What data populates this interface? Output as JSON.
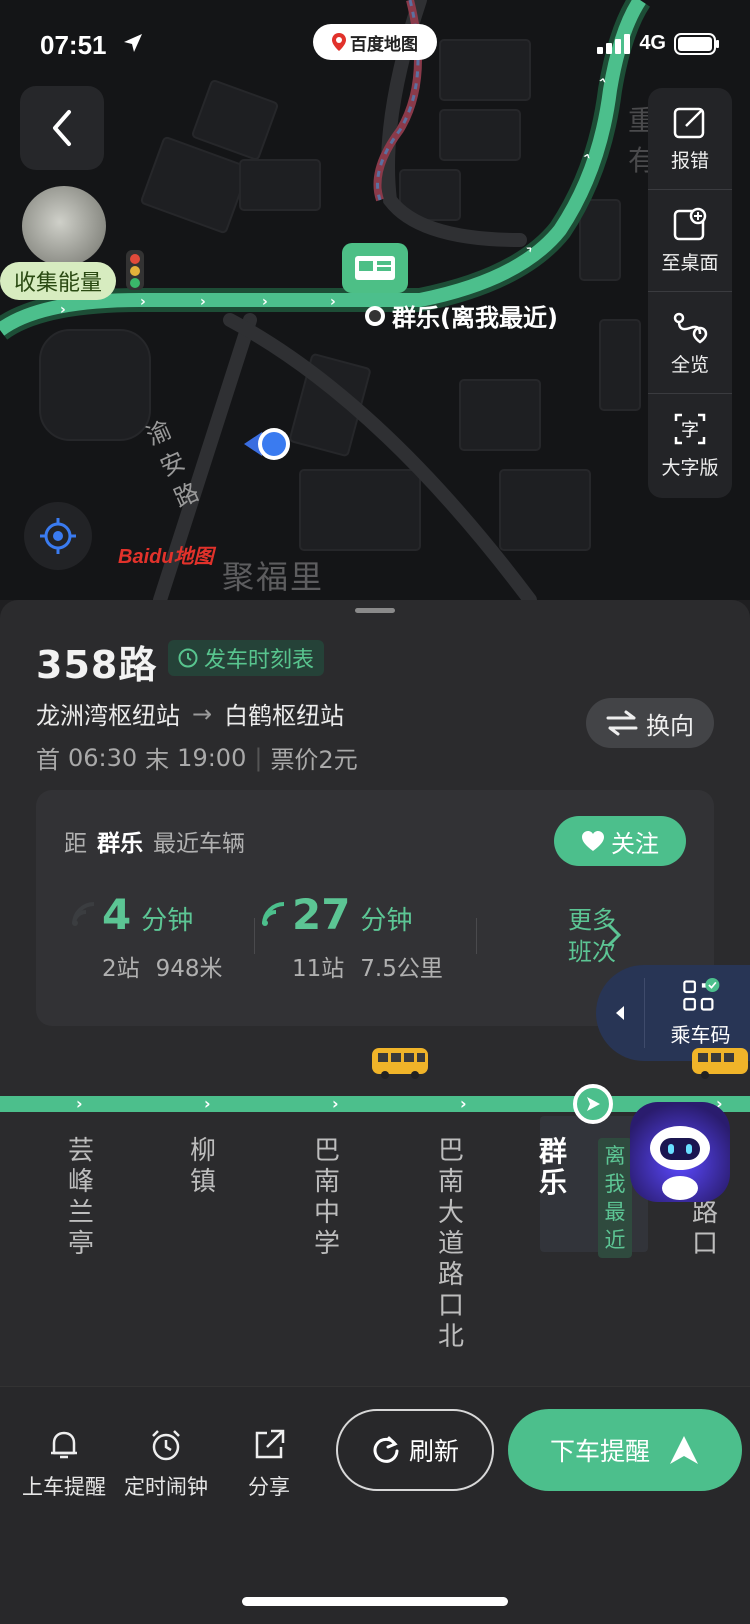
{
  "status_bar": {
    "time": "07:51",
    "network": "4G"
  },
  "app_pill": "百度地图",
  "map": {
    "energy_label": "收集能量",
    "stop_label": "群乐(离我最近)",
    "road_name": "渝安路",
    "area_name": "聚福里",
    "logo_text": "Baidu地图"
  },
  "side_panel": [
    {
      "label": "报错",
      "icon": "edit-icon"
    },
    {
      "label": "至桌面",
      "icon": "add-to-desktop-icon"
    },
    {
      "label": "全览",
      "icon": "route-overview-icon"
    },
    {
      "label": "大字版",
      "icon": "large-text-icon"
    }
  ],
  "route": {
    "name": "358路",
    "timetable_label": "发车时刻表",
    "from": "龙洲湾枢纽站",
    "to": "白鹤枢纽站",
    "first_label": "首",
    "first_time": "06:30",
    "last_label": "末",
    "last_time": "19:00",
    "fare": "票价2元",
    "swap_label": "换向"
  },
  "nearest": {
    "prefix": "距",
    "stop": "群乐",
    "suffix": "最近车辆",
    "follow_label": "关注",
    "buses": [
      {
        "minutes": "4",
        "unit": "分钟",
        "stops": "2站",
        "distance": "948米"
      },
      {
        "minutes": "27",
        "unit": "分钟",
        "stops": "11站",
        "distance": "7.5公里"
      }
    ],
    "more_label_1": "更多",
    "more_label_2": "班次"
  },
  "ride_code_label": "乘车码",
  "stops": [
    {
      "name": "芸峰兰亭",
      "chars": [
        "芸",
        "峰",
        "兰",
        "亭"
      ]
    },
    {
      "name": "柳镇",
      "chars": [
        "柳",
        "镇"
      ]
    },
    {
      "name": "巴南中学",
      "chars": [
        "巴",
        "南",
        "中",
        "学"
      ]
    },
    {
      "name": "巴南大道路口北",
      "chars": [
        "巴",
        "南",
        "大",
        "道",
        "路",
        "口",
        "北"
      ]
    },
    {
      "name": "群乐",
      "chars": [
        "群",
        "乐"
      ],
      "current": true
    },
    {
      "name": "…龙路口",
      "chars": [
        "…",
        "龙",
        "路",
        "口"
      ]
    }
  ],
  "nearest_tag": [
    "离",
    "我",
    "最",
    "近"
  ],
  "bottom": {
    "board_reminder": "上车提醒",
    "alarm": "定时闹钟",
    "share": "分享",
    "refresh": "刷新",
    "alight_reminder": "下车提醒"
  },
  "colors": {
    "accent": "#4cbf8c",
    "background": "#2b2b2d",
    "map_bg": "#141517"
  }
}
